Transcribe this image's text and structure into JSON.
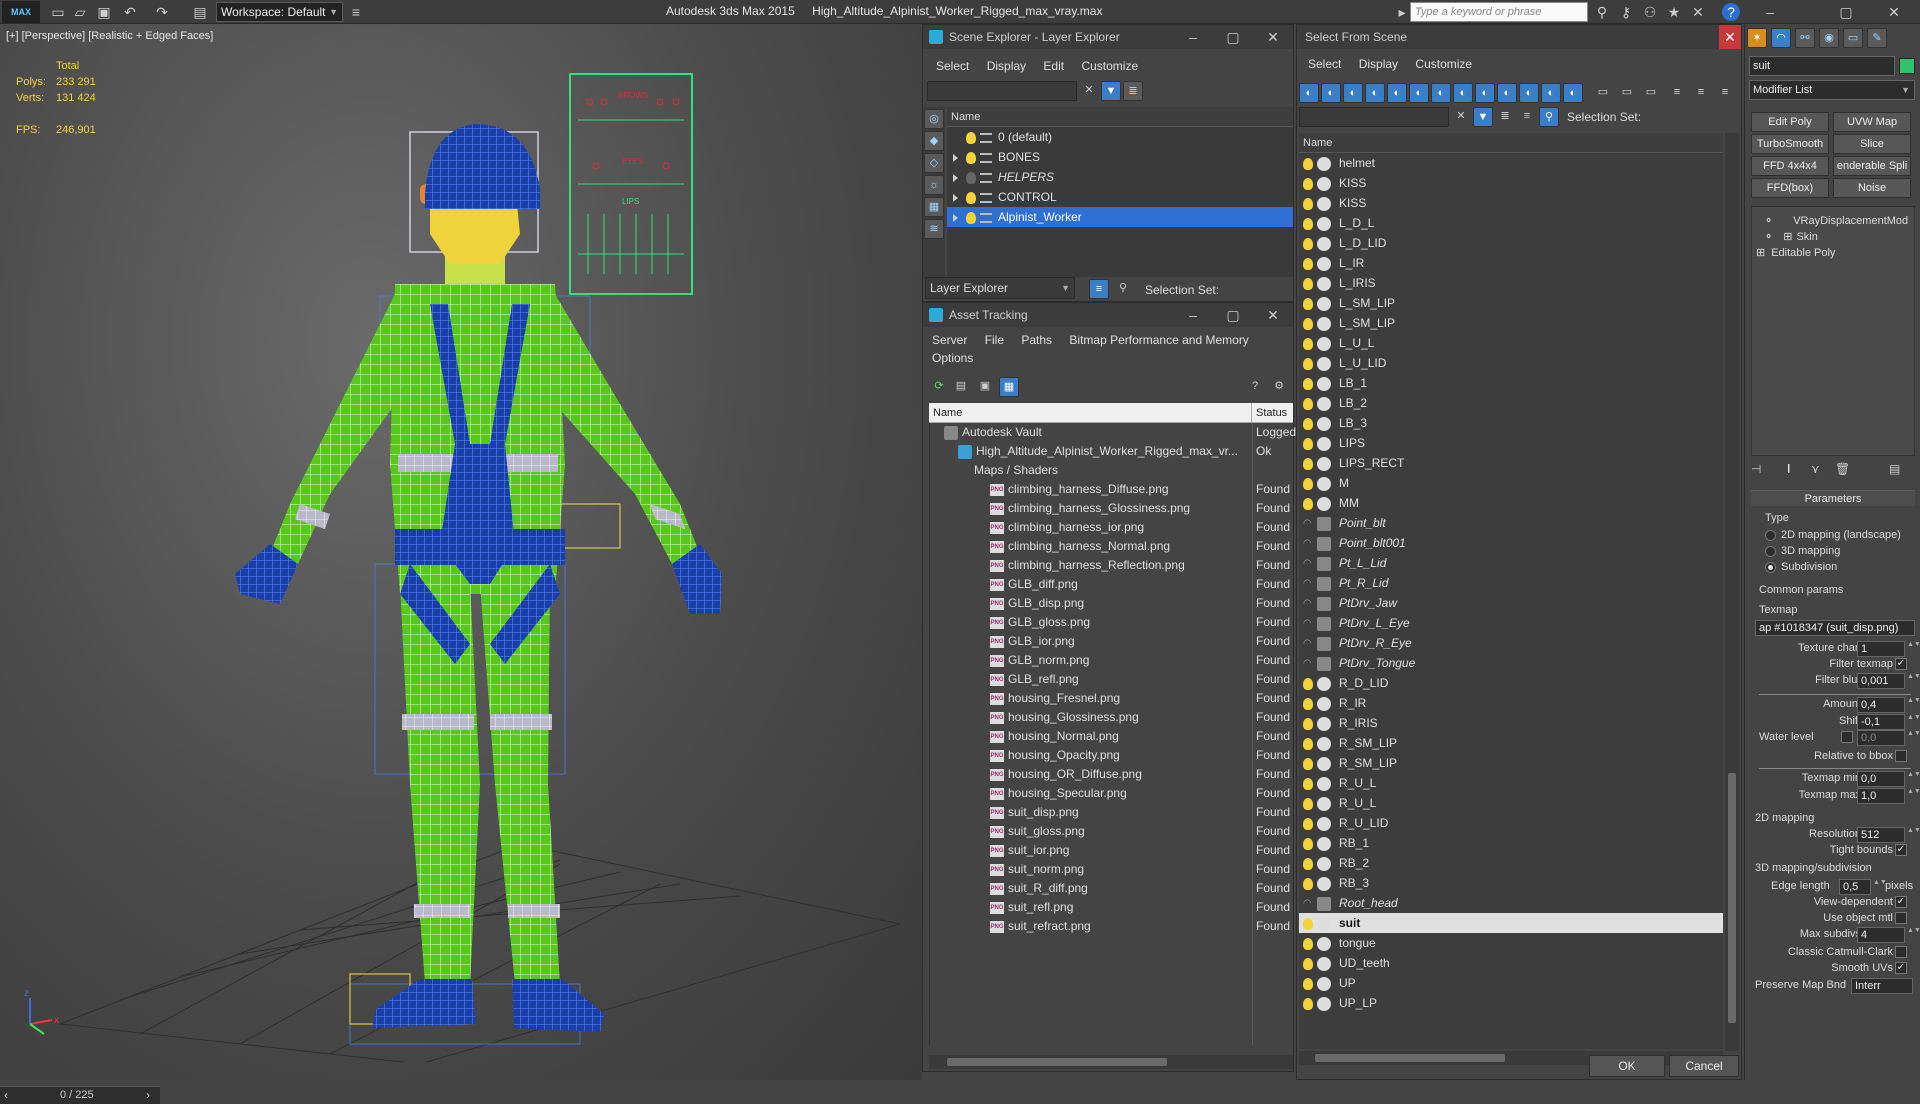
{
  "app": {
    "logo": "MAX",
    "workspace_label": "Workspace: Default",
    "product": "Autodesk 3ds Max  2015",
    "filename": "High_Altitude_Alpinist_Worker_Rigged_max_vray.max",
    "search_placeholder": "Type a keyword or phrase"
  },
  "viewport": {
    "label": "[+] [Perspective] [Realistic + Edged Faces]",
    "stats": {
      "total_label": "Total",
      "polys_label": "Polys:",
      "polys_value": "233 291",
      "verts_label": "Verts:",
      "verts_value": "131 424",
      "fps_label": "FPS:",
      "fps_value": "246,901"
    },
    "gizmo": {
      "z": "z",
      "x": "x"
    },
    "facial_controls": {
      "brows": "BROWS",
      "eyes": "EYES",
      "lips": "LIPS"
    },
    "timeline": "0 / 225"
  },
  "scene_explorer": {
    "title": "Scene Explorer - Layer Explorer",
    "menu": [
      "Select",
      "Display",
      "Edit",
      "Customize"
    ],
    "column": "Name",
    "layers": [
      {
        "name": "0 (default)",
        "expandable": false,
        "italic": false,
        "selected": false
      },
      {
        "name": "BONES",
        "expandable": true,
        "italic": false,
        "selected": false
      },
      {
        "name": "HELPERS",
        "expandable": true,
        "italic": true,
        "selected": false
      },
      {
        "name": "CONTROL",
        "expandable": true,
        "italic": false,
        "selected": false
      },
      {
        "name": "Alpinist_Worker",
        "expandable": true,
        "italic": false,
        "selected": true
      }
    ],
    "footer_label": "Layer Explorer",
    "selection_set_label": "Selection Set:"
  },
  "asset_tracking": {
    "title": "Asset Tracking",
    "menu": [
      "Server",
      "File",
      "Paths",
      "Bitmap Performance and Memory"
    ],
    "menu2": [
      "Options"
    ],
    "col_name": "Name",
    "col_status": "Status",
    "root": {
      "name": "Autodesk Vault",
      "status": "Logged"
    },
    "file": {
      "name": "High_Altitude_Alpinist_Worker_Rigged_max_vr...",
      "status": "Ok"
    },
    "folder": {
      "name": "Maps / Shaders",
      "status": ""
    },
    "files": [
      {
        "name": "climbing_harness_Diffuse.png",
        "status": "Found"
      },
      {
        "name": "climbing_harness_Glossiness.png",
        "status": "Found"
      },
      {
        "name": "climbing_harness_ior.png",
        "status": "Found"
      },
      {
        "name": "climbing_harness_Normal.png",
        "status": "Found"
      },
      {
        "name": "climbing_harness_Reflection.png",
        "status": "Found"
      },
      {
        "name": "GLB_diff.png",
        "status": "Found"
      },
      {
        "name": "GLB_disp.png",
        "status": "Found"
      },
      {
        "name": "GLB_gloss.png",
        "status": "Found"
      },
      {
        "name": "GLB_ior.png",
        "status": "Found"
      },
      {
        "name": "GLB_norm.png",
        "status": "Found"
      },
      {
        "name": "GLB_refl.png",
        "status": "Found"
      },
      {
        "name": "housing_Fresnel.png",
        "status": "Found"
      },
      {
        "name": "housing_Glossiness.png",
        "status": "Found"
      },
      {
        "name": "housing_Normal.png",
        "status": "Found"
      },
      {
        "name": "housing_Opacity.png",
        "status": "Found"
      },
      {
        "name": "housing_OR_Diffuse.png",
        "status": "Found"
      },
      {
        "name": "housing_Specular.png",
        "status": "Found"
      },
      {
        "name": "suit_disp.png",
        "status": "Found"
      },
      {
        "name": "suit_gloss.png",
        "status": "Found"
      },
      {
        "name": "suit_ior.png",
        "status": "Found"
      },
      {
        "name": "suit_norm.png",
        "status": "Found"
      },
      {
        "name": "suit_R_diff.png",
        "status": "Found"
      },
      {
        "name": "suit_refl.png",
        "status": "Found"
      },
      {
        "name": "suit_refract.png",
        "status": "Found"
      }
    ]
  },
  "select_from_scene": {
    "title": "Select From Scene",
    "menu": [
      "Select",
      "Display",
      "Customize"
    ],
    "selection_set_label": "Selection Set:",
    "column": "Name",
    "objects": [
      {
        "name": "helmet",
        "kind": "geo",
        "italic": false,
        "selected": false
      },
      {
        "name": "KISS",
        "kind": "geo",
        "italic": false,
        "selected": false
      },
      {
        "name": "KISS",
        "kind": "geo",
        "italic": false,
        "selected": false
      },
      {
        "name": "L_D_L",
        "kind": "geo",
        "italic": false,
        "selected": false
      },
      {
        "name": "L_D_LID",
        "kind": "geo",
        "italic": false,
        "selected": false
      },
      {
        "name": "L_IR",
        "kind": "geo",
        "italic": false,
        "selected": false
      },
      {
        "name": "L_IRIS",
        "kind": "geo",
        "italic": false,
        "selected": false
      },
      {
        "name": "L_SM_LIP",
        "kind": "geo",
        "italic": false,
        "selected": false
      },
      {
        "name": "L_SM_LIP",
        "kind": "geo",
        "italic": false,
        "selected": false
      },
      {
        "name": "L_U_L",
        "kind": "geo",
        "italic": false,
        "selected": false
      },
      {
        "name": "L_U_LID",
        "kind": "geo",
        "italic": false,
        "selected": false
      },
      {
        "name": "LB_1",
        "kind": "geo",
        "italic": false,
        "selected": false
      },
      {
        "name": "LB_2",
        "kind": "geo",
        "italic": false,
        "selected": false
      },
      {
        "name": "LB_3",
        "kind": "geo",
        "italic": false,
        "selected": false
      },
      {
        "name": "LIPS",
        "kind": "geo",
        "italic": false,
        "selected": false
      },
      {
        "name": "LIPS_RECT",
        "kind": "geo",
        "italic": false,
        "selected": false
      },
      {
        "name": "M",
        "kind": "geo",
        "italic": false,
        "selected": false
      },
      {
        "name": "MM",
        "kind": "geo",
        "italic": false,
        "selected": false
      },
      {
        "name": "Point_blt",
        "kind": "helper",
        "italic": true,
        "selected": false
      },
      {
        "name": "Point_blt001",
        "kind": "helper",
        "italic": true,
        "selected": false
      },
      {
        "name": "Pt_L_Lid",
        "kind": "helper",
        "italic": true,
        "selected": false
      },
      {
        "name": "Pt_R_Lid",
        "kind": "helper",
        "italic": true,
        "selected": false
      },
      {
        "name": "PtDrv_Jaw",
        "kind": "helper",
        "italic": true,
        "selected": false
      },
      {
        "name": "PtDrv_L_Eye",
        "kind": "helper",
        "italic": true,
        "selected": false
      },
      {
        "name": "PtDrv_R_Eye",
        "kind": "helper",
        "italic": true,
        "selected": false
      },
      {
        "name": "PtDrv_Tongue",
        "kind": "helper",
        "italic": true,
        "selected": false
      },
      {
        "name": "R_D_LID",
        "kind": "geo",
        "italic": false,
        "selected": false
      },
      {
        "name": "R_IR",
        "kind": "geo",
        "italic": false,
        "selected": false
      },
      {
        "name": "R_IRIS",
        "kind": "geo",
        "italic": false,
        "selected": false
      },
      {
        "name": "R_SM_LIP",
        "kind": "geo",
        "italic": false,
        "selected": false
      },
      {
        "name": "R_SM_LIP",
        "kind": "geo",
        "italic": false,
        "selected": false
      },
      {
        "name": "R_U_L",
        "kind": "geo",
        "italic": false,
        "selected": false
      },
      {
        "name": "R_U_L",
        "kind": "geo",
        "italic": false,
        "selected": false
      },
      {
        "name": "R_U_LID",
        "kind": "geo",
        "italic": false,
        "selected": false
      },
      {
        "name": "RB_1",
        "kind": "geo",
        "italic": false,
        "selected": false
      },
      {
        "name": "RB_2",
        "kind": "geo",
        "italic": false,
        "selected": false
      },
      {
        "name": "RB_3",
        "kind": "geo",
        "italic": false,
        "selected": false
      },
      {
        "name": "Root_head",
        "kind": "helper",
        "italic": true,
        "selected": false
      },
      {
        "name": "suit",
        "kind": "geo",
        "italic": false,
        "selected": true
      },
      {
        "name": "tongue",
        "kind": "geo",
        "italic": false,
        "selected": false
      },
      {
        "name": "UD_teeth",
        "kind": "geo",
        "italic": false,
        "selected": false
      },
      {
        "name": "UP",
        "kind": "geo",
        "italic": false,
        "selected": false
      },
      {
        "name": "UP_LP",
        "kind": "geo",
        "italic": false,
        "selected": false
      }
    ],
    "ok": "OK",
    "cancel": "Cancel"
  },
  "command_panel": {
    "object_name": "suit",
    "modifier_list": "Modifier List",
    "buttons": [
      "Edit Poly",
      "UVW Map",
      "TurboSmooth",
      "Slice",
      "FFD 4x4x4",
      "enderable Spli",
      "FFD(box)",
      "Noise"
    ],
    "stack": [
      "VRayDisplacementMod",
      "Skin",
      "Editable Poly"
    ],
    "rollout": "Parameters",
    "type_label": "Type",
    "types": [
      {
        "label": "2D mapping (landscape)",
        "on": false
      },
      {
        "label": "3D mapping",
        "on": false
      },
      {
        "label": "Subdivision",
        "on": true
      }
    ],
    "common_params": "Common params",
    "texmap_label": "Texmap",
    "texmap_value": "ap #1018347 (suit_disp.png)",
    "texture_chan_label": "Texture chan",
    "texture_chan": "1",
    "filter_texmap_label": "Filter texmap",
    "filter_texmap": "✓",
    "filter_blur_label": "Filter blur",
    "filter_blur": "0,001",
    "amount_label": "Amount",
    "amount": "0,4",
    "shift_label": "Shift",
    "shift": "-0,1",
    "water_level_label": "Water level",
    "water_level": "0,0",
    "relative_bbox_label": "Relative to bbox",
    "texmap_min_label": "Texmap min",
    "texmap_min": "0,0",
    "texmap_max_label": "Texmap max",
    "texmap_max": "1,0",
    "mapping2d_label": "2D mapping",
    "resolution_label": "Resolution",
    "resolution": "512",
    "tight_bounds_label": "Tight bounds",
    "tight_bounds": "✓",
    "mapping3d_label": "3D mapping/subdivision",
    "edge_length_label": "Edge length",
    "edge_length": "0,5",
    "pixels_label": "pixels",
    "view_dependent_label": "View-dependent",
    "view_dependent": "✓",
    "use_object_mtl_label": "Use object mtl",
    "max_subdivs_label": "Max subdivs",
    "max_subdivs": "4",
    "classic_cc_label": "Classic Catmull-Clark",
    "smooth_uvs_label": "Smooth UVs",
    "smooth_uvs": "✓",
    "preserve_label": "Preserve Map Bnd",
    "preserve_value": "Interr"
  }
}
